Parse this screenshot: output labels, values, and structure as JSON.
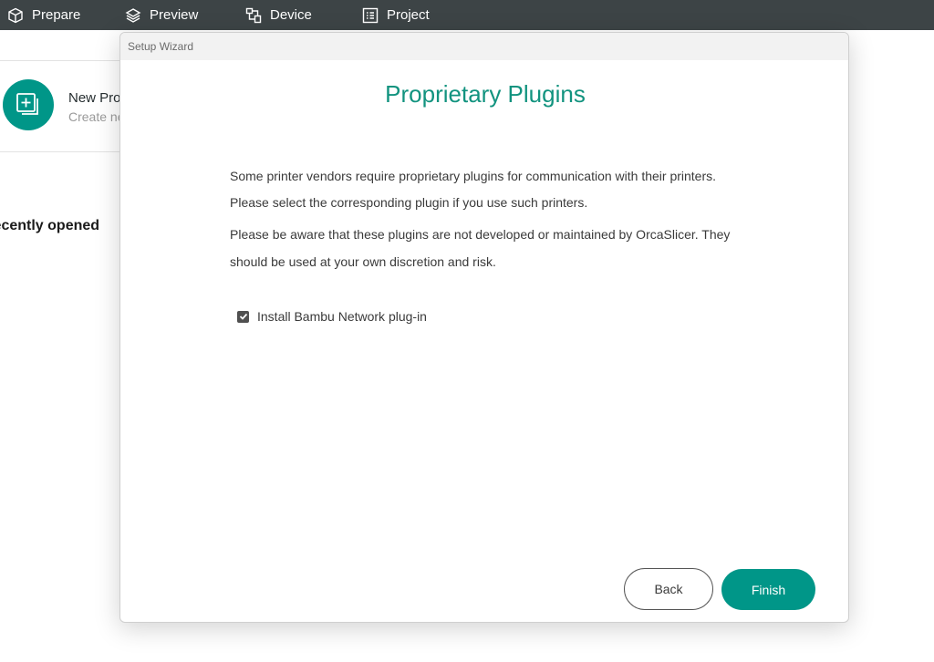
{
  "topbar": {
    "tabs": [
      {
        "label": "Prepare",
        "icon": "cube-icon"
      },
      {
        "label": "Preview",
        "icon": "layers-icon"
      },
      {
        "label": "Device",
        "icon": "device-icon"
      },
      {
        "label": "Project",
        "icon": "list-icon"
      }
    ]
  },
  "home": {
    "new_project_title": "New Project",
    "new_project_subtitle": "Create new project",
    "recent_heading": "Recently opened"
  },
  "dialog": {
    "window_title": "Setup Wizard",
    "heading": "Proprietary Plugins",
    "paragraphs": [
      "Some printer vendors require proprietary plugins for communication with their printers.",
      "Please select the corresponding plugin if you use such printers.",
      "Please be aware that these plugins are not developed or maintained by OrcaSlicer. They should be used at your own discretion and risk."
    ],
    "checkbox": {
      "label": "Install Bambu Network plug-in",
      "checked": true
    },
    "back_label": "Back",
    "finish_label": "Finish"
  },
  "colors": {
    "accent": "#009688",
    "heading": "#12937f",
    "topbar": "#3d4446"
  }
}
